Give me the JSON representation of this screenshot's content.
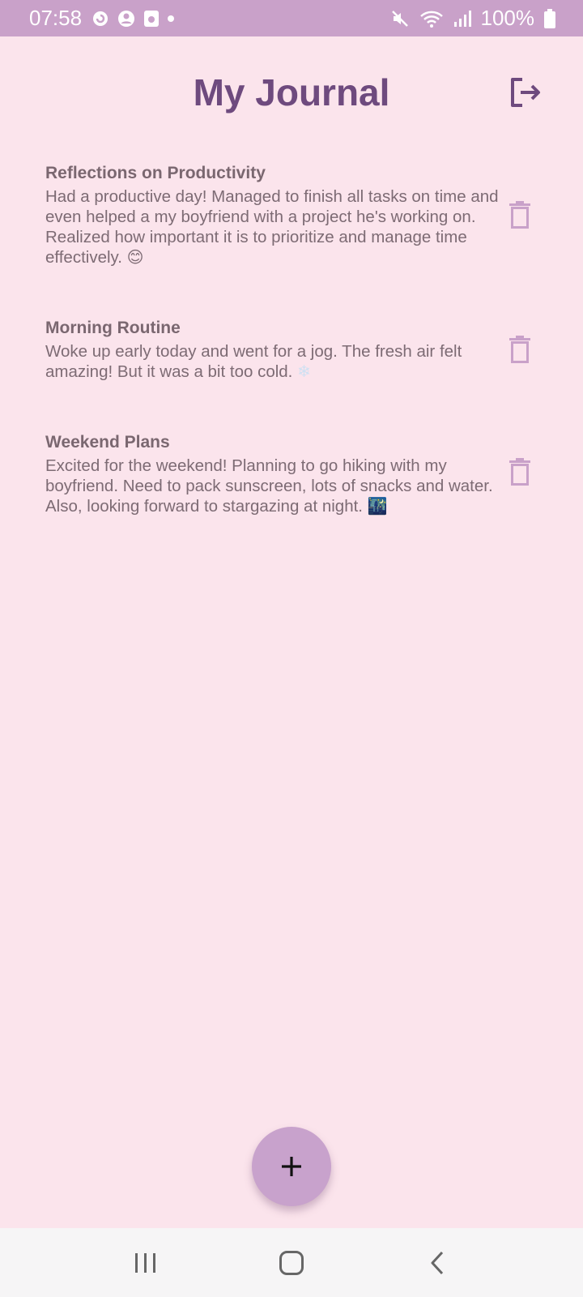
{
  "status_bar": {
    "time": "07:58",
    "battery": "100%",
    "left_icons": [
      "sync-icon",
      "account-icon",
      "media-icon",
      "dot-icon"
    ],
    "right_icons": [
      "mute-icon",
      "wifi-icon",
      "signal-icon",
      "battery-icon"
    ]
  },
  "header": {
    "title": "My Journal",
    "logout_icon": "logout-icon"
  },
  "entries": [
    {
      "title": "Reflections on Productivity",
      "body": "Had a productive day! Managed to finish all tasks on time and even helped a my boyfriend with a project he's working on. Realized how important it is to prioritize and manage time effectively.",
      "emoji": "😊"
    },
    {
      "title": "Morning Routine",
      "body": "Woke up early today and went for a jog. The fresh air felt amazing! But it was a bit too cold.",
      "emoji": "❄"
    },
    {
      "title": "Weekend Plans",
      "body": "Excited for the weekend! Planning to go hiking with my boyfriend. Need to pack sunscreen, lots of snacks and water. Also, looking forward to stargazing at night.",
      "emoji": "🌃"
    }
  ],
  "fab": {
    "icon": "plus-icon"
  },
  "nav": {
    "icons": [
      "recents-icon",
      "home-icon",
      "back-icon"
    ]
  },
  "colors": {
    "background": "#fbe4ec",
    "status_bar": "#c9a1c9",
    "title": "#6e4a7e",
    "icon_accent": "#c9a1c9",
    "fab": "#c8a2cc"
  }
}
